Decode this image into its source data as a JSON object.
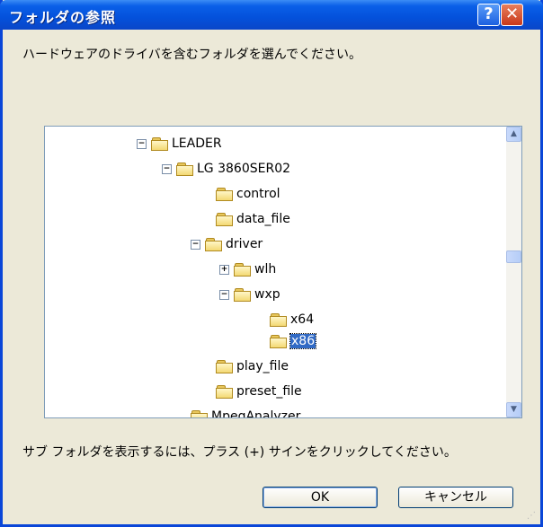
{
  "dialog": {
    "title": "フォルダの参照",
    "help_label": "?",
    "close_label": "✕",
    "prompt": "ハードウェアのドライバを含むフォルダを選んでください。",
    "hint": "サブ フォルダを表示するには、プラス (+) サインをクリックしてください。",
    "ok_label": "OK",
    "cancel_label": "キャンセル"
  },
  "tree": {
    "nodes": [
      {
        "label": "LEADER",
        "expander": "−"
      },
      {
        "label": "LG 3860SER02",
        "expander": "−"
      },
      {
        "label": "control",
        "expander": ""
      },
      {
        "label": "data_file",
        "expander": ""
      },
      {
        "label": "driver",
        "expander": "−"
      },
      {
        "label": "wlh",
        "expander": "+"
      },
      {
        "label": "wxp",
        "expander": "−"
      },
      {
        "label": "x64",
        "expander": ""
      },
      {
        "label": "x86",
        "expander": "",
        "selected": true
      },
      {
        "label": "play_file",
        "expander": ""
      },
      {
        "label": "preset_file",
        "expander": ""
      },
      {
        "label": "MpegAnalyzer",
        "expander": ""
      }
    ],
    "scroll_up": "▲",
    "scroll_down": "▼"
  },
  "colors": {
    "selection": "#316ac5",
    "titlebar": "#0a5fe8"
  }
}
